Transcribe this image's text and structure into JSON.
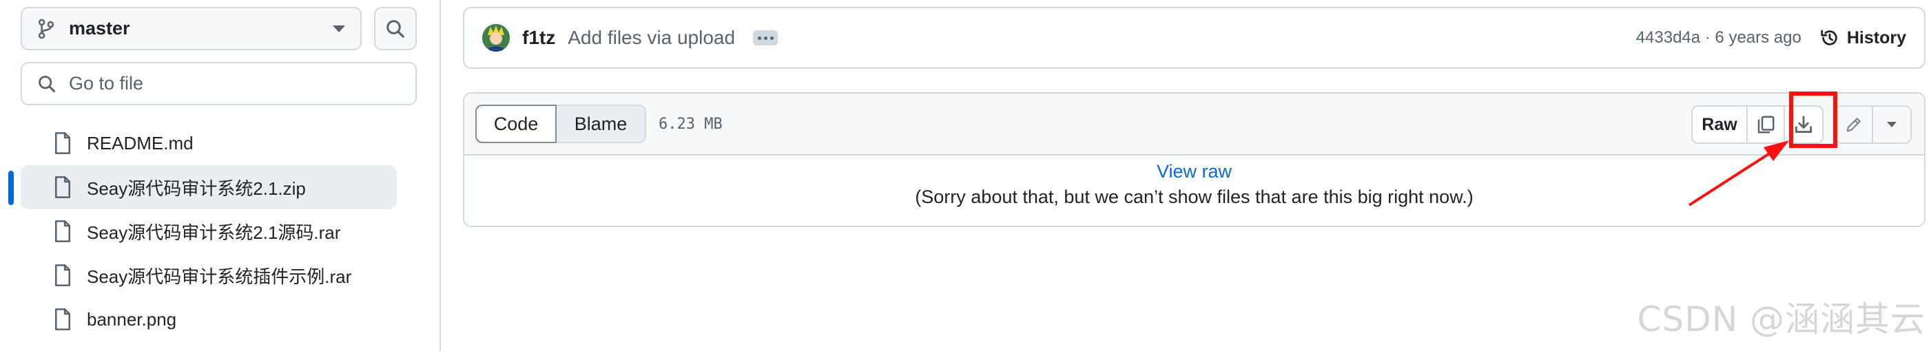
{
  "sidebar": {
    "branch": "master",
    "goto_placeholder": "Go to file",
    "files": [
      {
        "label": "README.md",
        "active": false
      },
      {
        "label": "Seay源代码审计系统2.1.zip",
        "active": true
      },
      {
        "label": "Seay源代码审计系统2.1源码.rar",
        "active": false
      },
      {
        "label": "Seay源代码审计系统插件示例.rar",
        "active": false
      },
      {
        "label": "banner.png",
        "active": false
      }
    ]
  },
  "commit": {
    "author": "f1tz",
    "message": "Add files via upload",
    "hash": "4433d4a",
    "age": "6 years ago",
    "meta": "4433d4a · 6 years ago",
    "history_label": "History"
  },
  "file_view": {
    "tabs": {
      "code": "Code",
      "blame": "Blame"
    },
    "size": "6.23 MB",
    "raw_label": "Raw",
    "view_raw_link": "View raw",
    "too_big_message": "(Sorry about that, but we can’t show files that are this big right now.)"
  },
  "icons": {
    "branch": "git-branch-icon",
    "search": "search-icon",
    "file": "file-icon",
    "history": "history-icon",
    "copy": "copy-icon",
    "download": "download-icon",
    "edit": "pencil-icon",
    "dropdown": "triangle-down-icon"
  },
  "annotation": {
    "highlight_color": "#ff1010"
  },
  "watermark": "CSDN @涵涵其云",
  "colors": {
    "link": "#0969da",
    "border": "#d1d9e0",
    "muted": "#59636e",
    "active_indicator": "#0969da"
  }
}
